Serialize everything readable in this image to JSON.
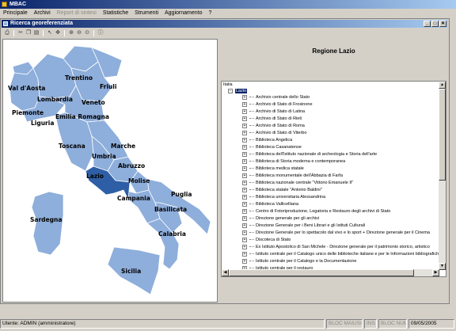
{
  "app": {
    "title": "MBAC"
  },
  "menu": [
    "Principale",
    "Archivi",
    "Report di sintesi",
    "Statistiche",
    "Strumenti",
    "Aggiornamento",
    "?"
  ],
  "menu_disabled_index": 2,
  "window": {
    "title": "Ricerca georeferenziata",
    "buttons": [
      "_",
      "□",
      "✕"
    ]
  },
  "toolbar": {
    "icons": [
      "print-icon",
      "cut-icon",
      "copy-icon",
      "paste-icon",
      "pointer-icon",
      "pan-icon",
      "zoom-in-icon",
      "zoom-out-icon",
      "zoom-extent-icon",
      "info-icon"
    ]
  },
  "map": {
    "highlight_color": "#2e5fa6",
    "region_color": "#8eaedb",
    "labels": {
      "valdaosta": "Val d'Aosta",
      "trentino": "Trentino",
      "friuli": "Friuli",
      "lombardia": "Lombardia",
      "veneto": "Veneto",
      "piemonte": "Piemonte",
      "emilia": "Emilia Romagna",
      "liguria": "Liguria",
      "toscana": "Toscana",
      "marche": "Marche",
      "umbria": "Umbria",
      "abruzzo": "Abruzzo",
      "lazio": "Lazio",
      "molise": "Molise",
      "campania": "Campania",
      "puglia": "Puglia",
      "basilicata": "Basilicata",
      "sardegna": "Sardegna",
      "calabria": "Calabria",
      "sicilia": "Sicilia"
    }
  },
  "panel": {
    "title": "Regione Lazio"
  },
  "tree": {
    "root": "Italia",
    "region": "Lazio",
    "items": [
      "Archivio centrale dello Stato",
      "Archivio di Stato di Frosinone",
      "Archivio di Stato di Latina",
      "Archivio di Stato di Rieti",
      "Archivio di Stato di Roma",
      "Archivio di Stato di Viterbo",
      "Biblioteca Angelica",
      "Biblioteca Casanatense",
      "Biblioteca dell'Istituto nazionale di archeologia e Storia dell'arte",
      "Biblioteca di Storia moderna e contemporanea",
      "Biblioteca medica statale",
      "Biblioteca monumentale dell'Abbazia di Farfa",
      "Biblioteca nazionale centrale \"Vittorio Emanuele II\"",
      "Biblioteca statale \"Antonio Baldini\"",
      "Biblioteca universitaria Alessandrina",
      "Biblioteca Vallicelliana",
      "Centro di Fotoriproduzione, Legatoria e Restauro degli archivi di Stato",
      "Direzione generale per gli archivi",
      "Direzione Generale per i Beni Librari e gli Istituti Culturali",
      "Direzione Generale per lo spettacolo dal vivo e lo sport + Direzione generale per il Cinema",
      "Discoteca di Stato",
      "Ex Istituto Apostolico di San Michele - Direzione generale per il patrimonio storico, artistico",
      "Istituto centrale  per il Catalogo unico delle biblioteche italiane e per le Informazioni bibliografiche",
      "Istituto centrale per il Catalogo e la Documentazione",
      "Istituto centrale per il restauro"
    ]
  },
  "status": {
    "user": "Utente: ADMIN (amministratore)",
    "caps": "BLOC MAIUSC",
    "ins": "INS",
    "num": "BLOC NUM",
    "date": "09/05/2005"
  }
}
